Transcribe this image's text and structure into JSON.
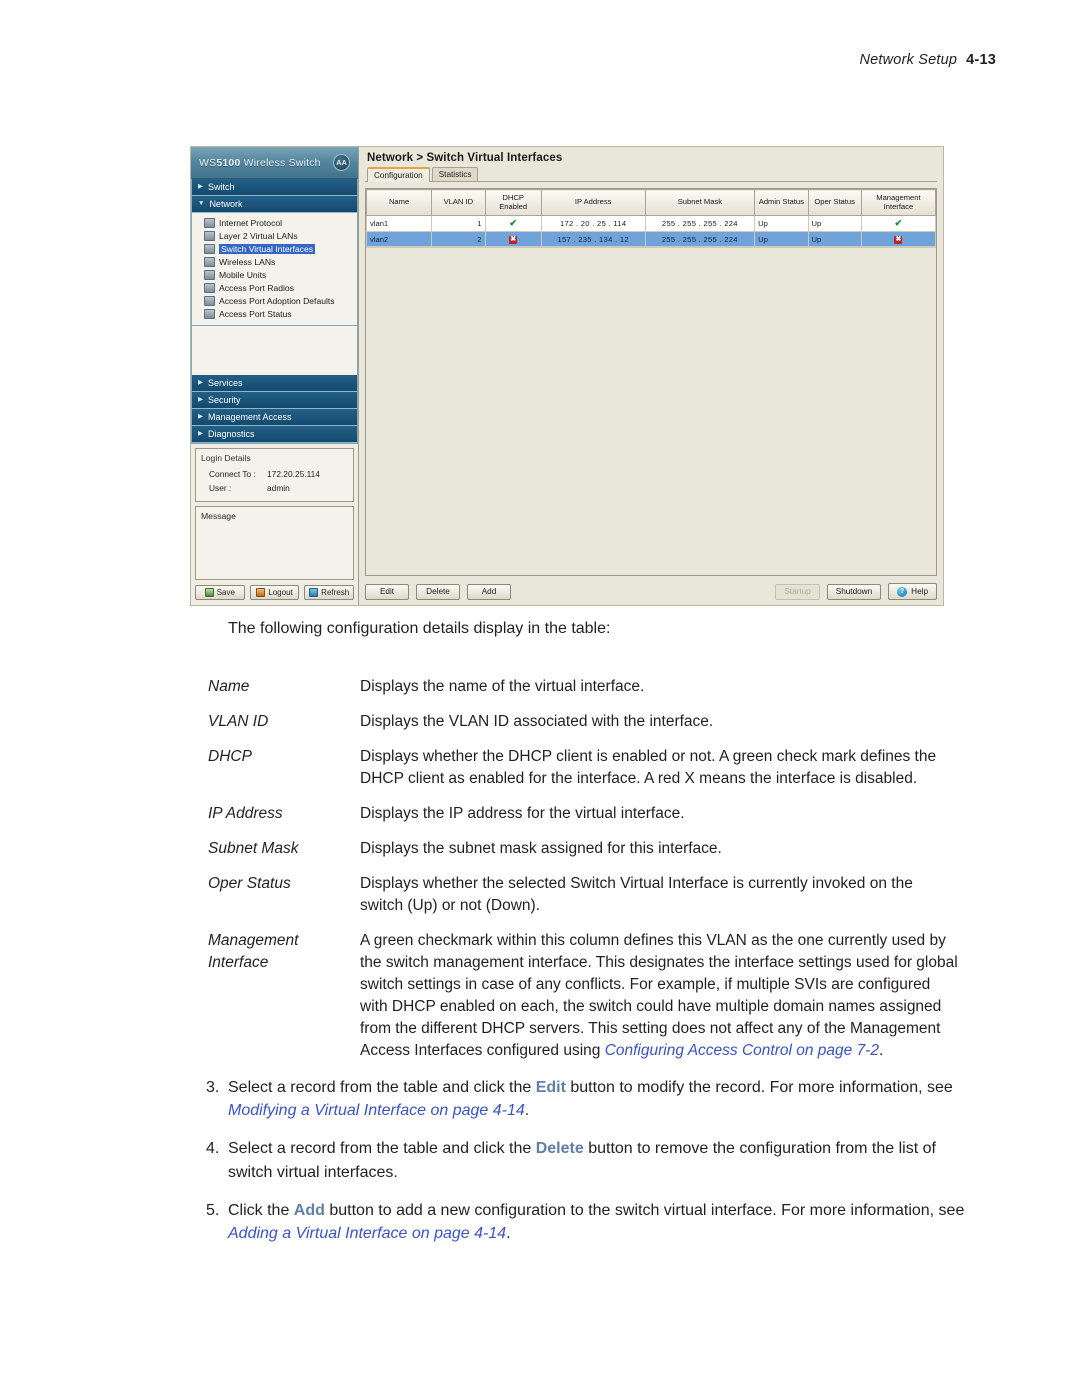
{
  "page_header": {
    "title": "Network Setup",
    "number": "4-13"
  },
  "screenshot": {
    "app": {
      "logo_text_prefix": "WS",
      "logo_text_model": "5100",
      "logo_text_suffix": " Wireless Switch",
      "logo_badge": "AA"
    },
    "sidebar": {
      "sections": [
        {
          "label": "Switch",
          "expanded": false
        },
        {
          "label": "Network",
          "expanded": true
        }
      ],
      "network_items": [
        {
          "label": "Internet Protocol",
          "icon": "network-protocol-icon",
          "selected": false
        },
        {
          "label": "Layer 2 Virtual LANs",
          "icon": "vlan-icon",
          "selected": false
        },
        {
          "label": "Switch Virtual Interfaces",
          "icon": "svi-icon",
          "selected": true
        },
        {
          "label": "Wireless LANs",
          "icon": "wlan-icon",
          "selected": false
        },
        {
          "label": "Mobile Units",
          "icon": "mobile-unit-icon",
          "selected": false
        },
        {
          "label": "Access Port Radios",
          "icon": "radio-icon",
          "selected": false
        },
        {
          "label": "Access Port Adoption Defaults",
          "icon": "adoption-icon",
          "selected": false
        },
        {
          "label": "Access Port Status",
          "icon": "port-status-icon",
          "selected": false
        }
      ],
      "lower_sections": [
        {
          "label": "Services"
        },
        {
          "label": "Security"
        },
        {
          "label": "Management Access"
        },
        {
          "label": "Diagnostics"
        }
      ],
      "login_details": {
        "legend": "Login Details",
        "connect_to_label": "Connect To :",
        "connect_to_value": "172.20.25.114",
        "user_label": "User :",
        "user_value": "admin"
      },
      "message_legend": "Message",
      "buttons": [
        {
          "label": "Save",
          "icon": "save-icon"
        },
        {
          "label": "Logout",
          "icon": "logout-icon"
        },
        {
          "label": "Refresh",
          "icon": "refresh-icon"
        }
      ]
    },
    "main": {
      "title": "Network > Switch Virtual Interfaces",
      "tabs": [
        {
          "label": "Configuration",
          "active": true
        },
        {
          "label": "Statistics",
          "active": false
        }
      ],
      "table": {
        "columns": [
          "Name",
          "VLAN ID",
          "DHCP Enabled",
          "IP Address",
          "Subnet Mask",
          "Admin Status",
          "Oper Status",
          "Management Interface"
        ],
        "rows": [
          {
            "name": "vlan1",
            "vlan_id": "1",
            "dhcp_enabled": "check",
            "ip_address": "172 . 20 . 25 . 114",
            "subnet_mask": "255 . 255 . 255 . 224",
            "admin_status": "Up",
            "oper_status": "Up",
            "management_interface": "check",
            "selected": false
          },
          {
            "name": "vlan2",
            "vlan_id": "2",
            "dhcp_enabled": "cross",
            "ip_address": "157 . 235 . 134 . 12",
            "subnet_mask": "255 . 255 . 255 . 224",
            "admin_status": "Up",
            "oper_status": "Up",
            "management_interface": "cross",
            "selected": true
          }
        ]
      },
      "buttons_left": [
        {
          "label": "Edit",
          "disabled": false
        },
        {
          "label": "Delete",
          "disabled": false
        },
        {
          "label": "Add",
          "disabled": false
        }
      ],
      "buttons_right": [
        {
          "label": "Startup",
          "disabled": true
        },
        {
          "label": "Shutdown",
          "disabled": false
        },
        {
          "label": "Help",
          "disabled": false,
          "icon": "help-icon"
        }
      ]
    }
  },
  "body": {
    "intro": "The following configuration details display in the table:",
    "definitions": [
      {
        "term": "Name",
        "desc": "Displays the name of the virtual interface."
      },
      {
        "term": "VLAN ID",
        "desc": "Displays the VLAN ID associated with the interface."
      },
      {
        "term": "DHCP",
        "desc": "Displays whether the DHCP client is enabled or not. A green check mark defines the DHCP client as enabled for the interface. A red X means the interface is disabled."
      },
      {
        "term": "IP Address",
        "desc": "Displays the IP address for the virtual interface."
      },
      {
        "term": "Subnet Mask",
        "desc": "Displays the subnet mask assigned for this interface."
      },
      {
        "term": "Oper Status",
        "desc": "Displays whether the selected Switch Virtual Interface is currently invoked on the switch (Up) or not (Down)."
      },
      {
        "term_line1": "Management",
        "term_line2": "Interface",
        "desc_pre": "A green checkmark within this column defines this VLAN as the one currently used by the switch management interface. This designates the interface settings used for global switch settings in case of any conflicts. For example, if multiple SVIs are configured with DHCP enabled on each, the switch could have multiple domain names assigned from the different DHCP servers. This setting does not affect any of the Management Access Interfaces configured using ",
        "desc_link": "Configuring Access Control on page 7-2",
        "desc_post": "."
      }
    ],
    "steps": [
      {
        "num": "3.",
        "pre": "Select a record from the table and click the ",
        "bold": "Edit",
        "mid": " button to modify the record. For more information, see ",
        "link": "Modifying a Virtual Interface on page 4-14",
        "post": "."
      },
      {
        "num": "4.",
        "pre": "Select a record from the table and click the ",
        "bold": "Delete",
        "mid": " button to remove the configuration from the list of switch virtual interfaces.",
        "link": "",
        "post": ""
      },
      {
        "num": "5.",
        "pre": "Click the ",
        "bold": "Add",
        "mid": " button to add a new configuration to the switch virtual interface. For more information, see ",
        "link": "Adding a Virtual Interface on page 4-14",
        "post": "."
      }
    ]
  },
  "colors": {
    "link": "#3a53c4",
    "bold_accent": "#5d7fa8",
    "sidebar_section": "#0f4a73",
    "selection": "#6ea3e0",
    "check_green": "#128a2a",
    "cross_red": "#c0241f"
  }
}
